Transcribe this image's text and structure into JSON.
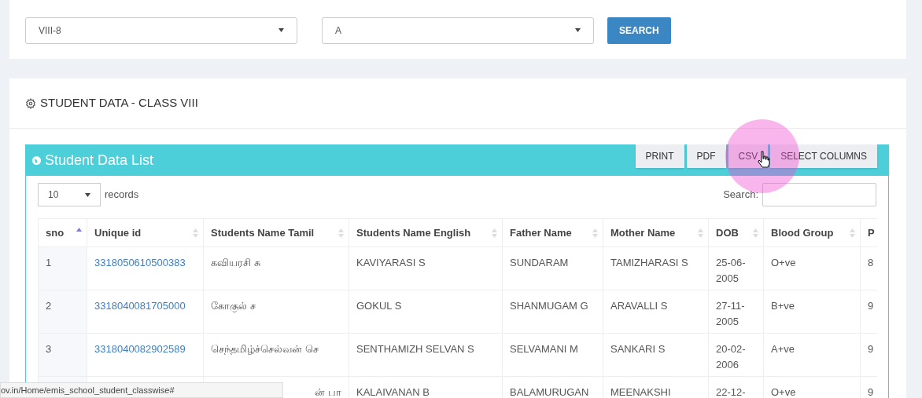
{
  "filters": {
    "class_select": {
      "value": "VIII-8"
    },
    "section_select": {
      "value": "A"
    },
    "search_button": "SEARCH"
  },
  "section_title": "STUDENT DATA - CLASS VIII",
  "panel": {
    "title": "Student Data List",
    "export_buttons": [
      {
        "label": "PRINT"
      },
      {
        "label": "PDF"
      },
      {
        "label": "CSV"
      },
      {
        "label": "SELECT COLUMNS"
      }
    ]
  },
  "length_select": {
    "value": "10",
    "suffix": "records"
  },
  "search": {
    "label": "Search:"
  },
  "table": {
    "columns": [
      {
        "label": "sno",
        "sorted": true
      },
      {
        "label": "Unique id",
        "sorted": false
      },
      {
        "label": "Students Name Tamil",
        "sorted": false
      },
      {
        "label": "Students Name English",
        "sorted": false
      },
      {
        "label": "Father Name",
        "sorted": false
      },
      {
        "label": "Mother Name",
        "sorted": false
      },
      {
        "label": "DOB",
        "sorted": false
      },
      {
        "label": "Blood Group",
        "sorted": false
      },
      {
        "label": "P"
      }
    ],
    "rows": [
      {
        "sno": "1",
        "unique_id": "3318050610500383",
        "name_tamil": "கவியரசி சு",
        "name_english": "KAVIYARASI S",
        "father": "SUNDARAM",
        "mother": "TAMIZHARASI S",
        "dob": "25-06-2005",
        "blood": "O+ve",
        "column_9": "8"
      },
      {
        "sno": "2",
        "unique_id": "3318040081705000",
        "name_tamil": "கோகுல் ச",
        "name_english": "GOKUL S",
        "father": "SHANMUGAM G",
        "mother": "ARAVALLI S",
        "dob": "27-11-2005",
        "blood": "B+ve",
        "column_9": "9"
      },
      {
        "sno": "3",
        "unique_id": "3318040082902589",
        "name_tamil": "செந்தமிழ்ச்செல்வன் செ",
        "name_english": "SENTHAMIZH SELVAN S",
        "father": "SELVAMANI M",
        "mother": "SANKARI S",
        "dob": "20-02-2006",
        "blood": "A+ve",
        "column_9": "9"
      },
      {
        "name_tamil": "ன் பா",
        "clipped": true,
        "name_english": "KALAIVANAN B",
        "father": "BALAMURUGAN",
        "mother": "MEENAKSHI",
        "dob": "22-12-",
        "blood": "O+ve",
        "column_9": "9"
      }
    ]
  },
  "status_bar": {
    "url": "ov.in/Home/emis_school_student_classwise#"
  }
}
